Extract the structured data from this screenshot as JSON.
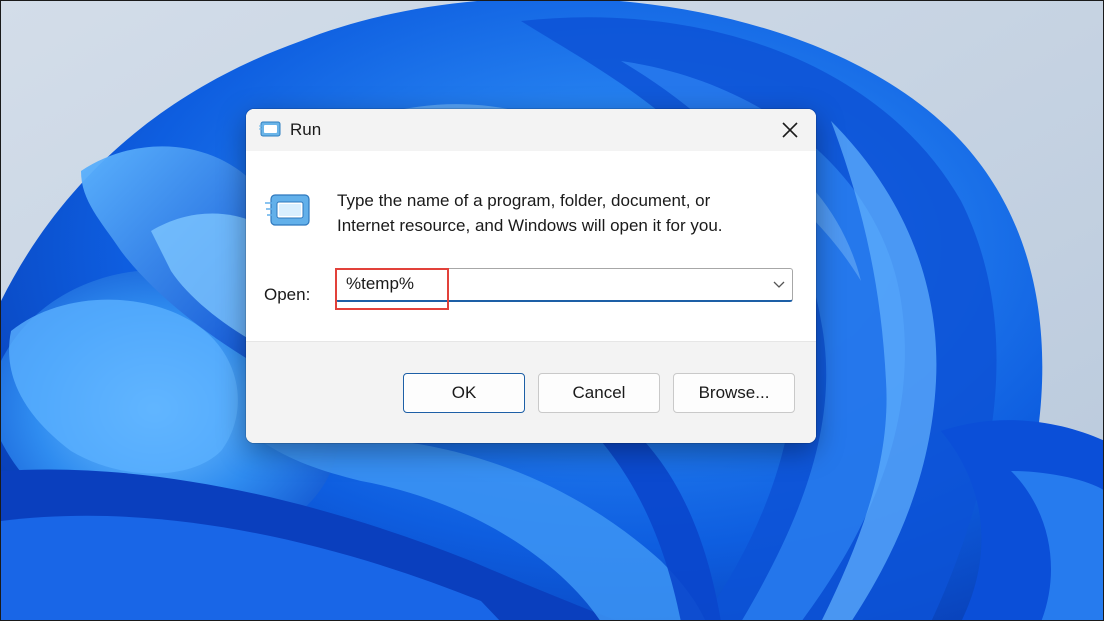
{
  "window": {
    "title": "Run",
    "title_icon": "run-icon",
    "close_icon": "close-icon"
  },
  "dialog": {
    "description_line1": "Type the name of a program, folder, document, or",
    "description_line2": "Internet resource, and Windows will open it for you.",
    "program_icon": "run-icon",
    "open_label": "Open:",
    "open_value": "%temp%",
    "dropdown_icon": "chevron-down-icon"
  },
  "buttons": {
    "ok": "OK",
    "cancel": "Cancel",
    "browse": "Browse..."
  },
  "colors": {
    "accent": "#1d5fa6",
    "highlight": "#e2413a",
    "wallpaper_primary": "#1565e6"
  }
}
